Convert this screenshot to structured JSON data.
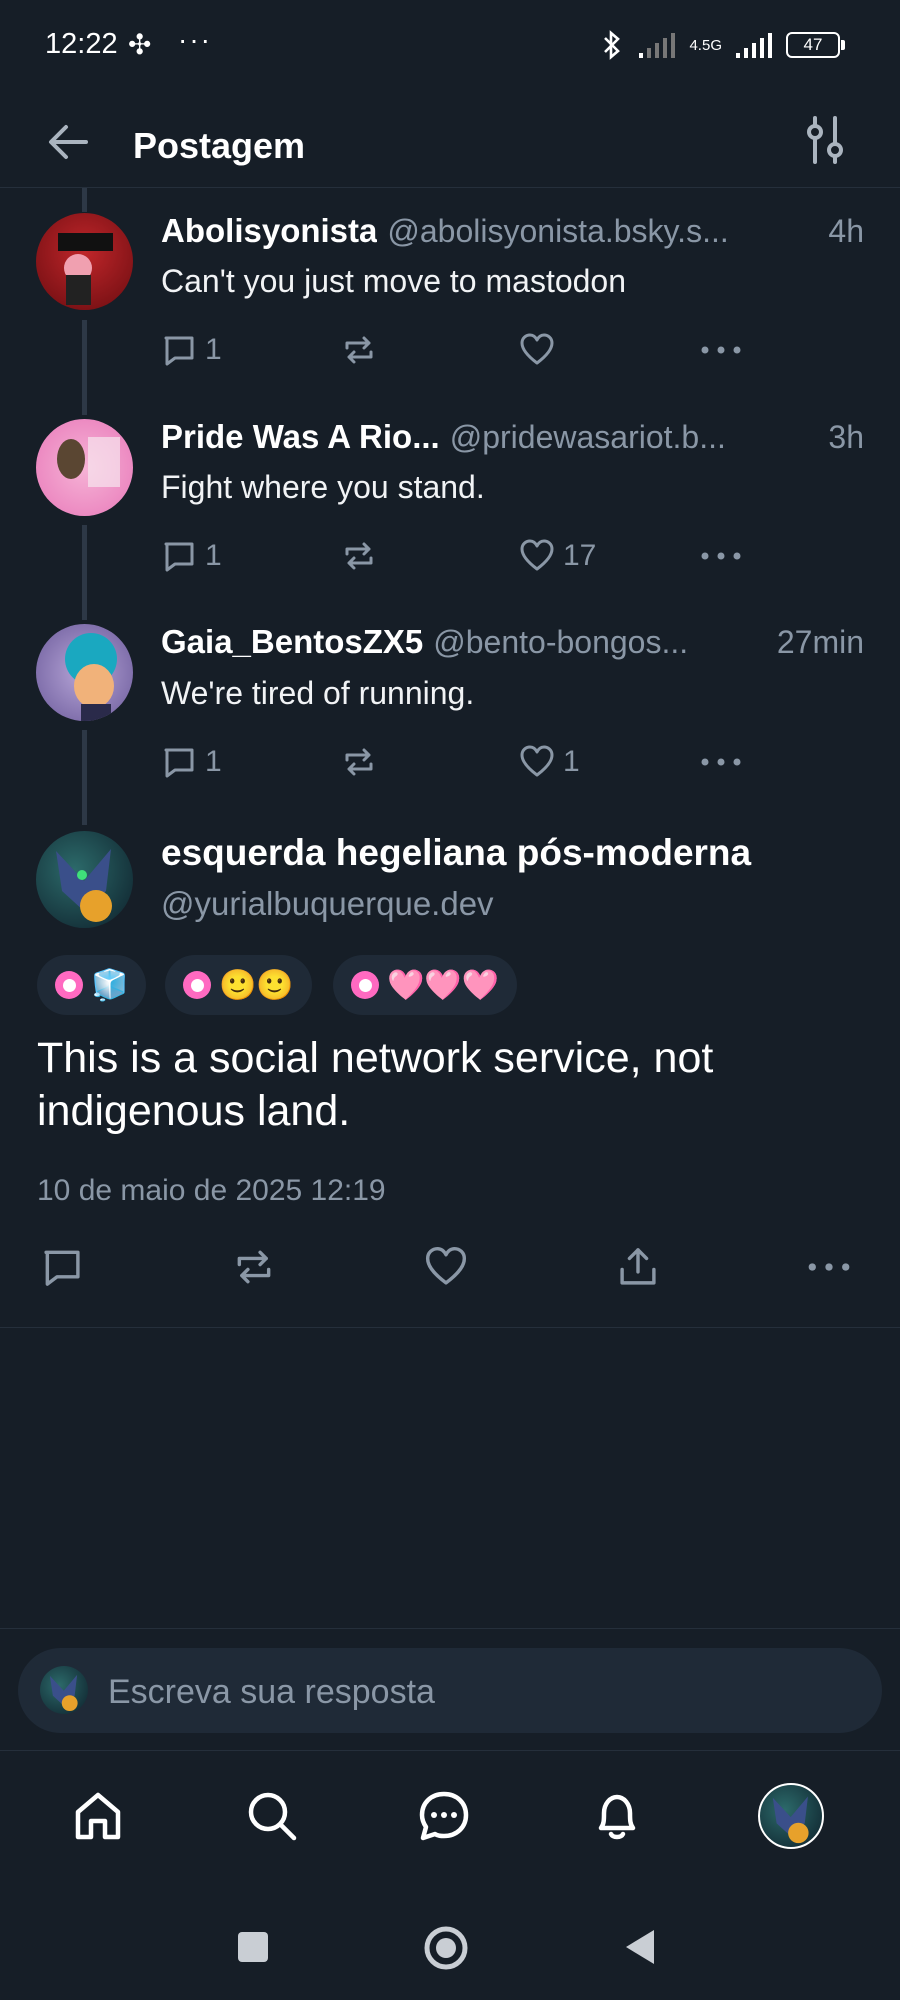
{
  "status_bar": {
    "time": "12:22",
    "network": "4.5G",
    "battery": "47"
  },
  "header": {
    "title": "Postagem"
  },
  "thread": [
    {
      "name": "Abolisyonista",
      "handle": "@abolisyonista.bsky.s...",
      "time": "4h",
      "text": "Can't you just move to mastodon",
      "replies": "1",
      "reposts": "",
      "likes": ""
    },
    {
      "name": "Pride Was A Rio...",
      "handle": "@pridewasariot.b...",
      "time": "3h",
      "text": "Fight where you stand.",
      "replies": "1",
      "reposts": "",
      "likes": "17"
    },
    {
      "name": "Gaia_BentosZX5",
      "handle": "@bento-bongos...",
      "time": "27min",
      "text": "We're tired of running.",
      "replies": "1",
      "reposts": "",
      "likes": "1"
    }
  ],
  "main_post": {
    "name": "esquerda hegeliana pós-moderna",
    "handle": "@yurialbuquerque.dev",
    "chips": [
      "🧊",
      "🙂🙂",
      "🩷🩷🩷"
    ],
    "text": "This is a social network service, not indigenous land.",
    "date": "10 de maio de 2025 12:19"
  },
  "composer": {
    "placeholder": "Escreva sua resposta"
  },
  "colors": {
    "background": "#161e27",
    "muted": "#8a97a6",
    "chip_bg": "#1f2a37",
    "pink": "#ff6ac1"
  },
  "nav": {
    "items": [
      "home-icon",
      "search-icon",
      "chat-icon",
      "bell-icon",
      "profile-avatar"
    ]
  }
}
